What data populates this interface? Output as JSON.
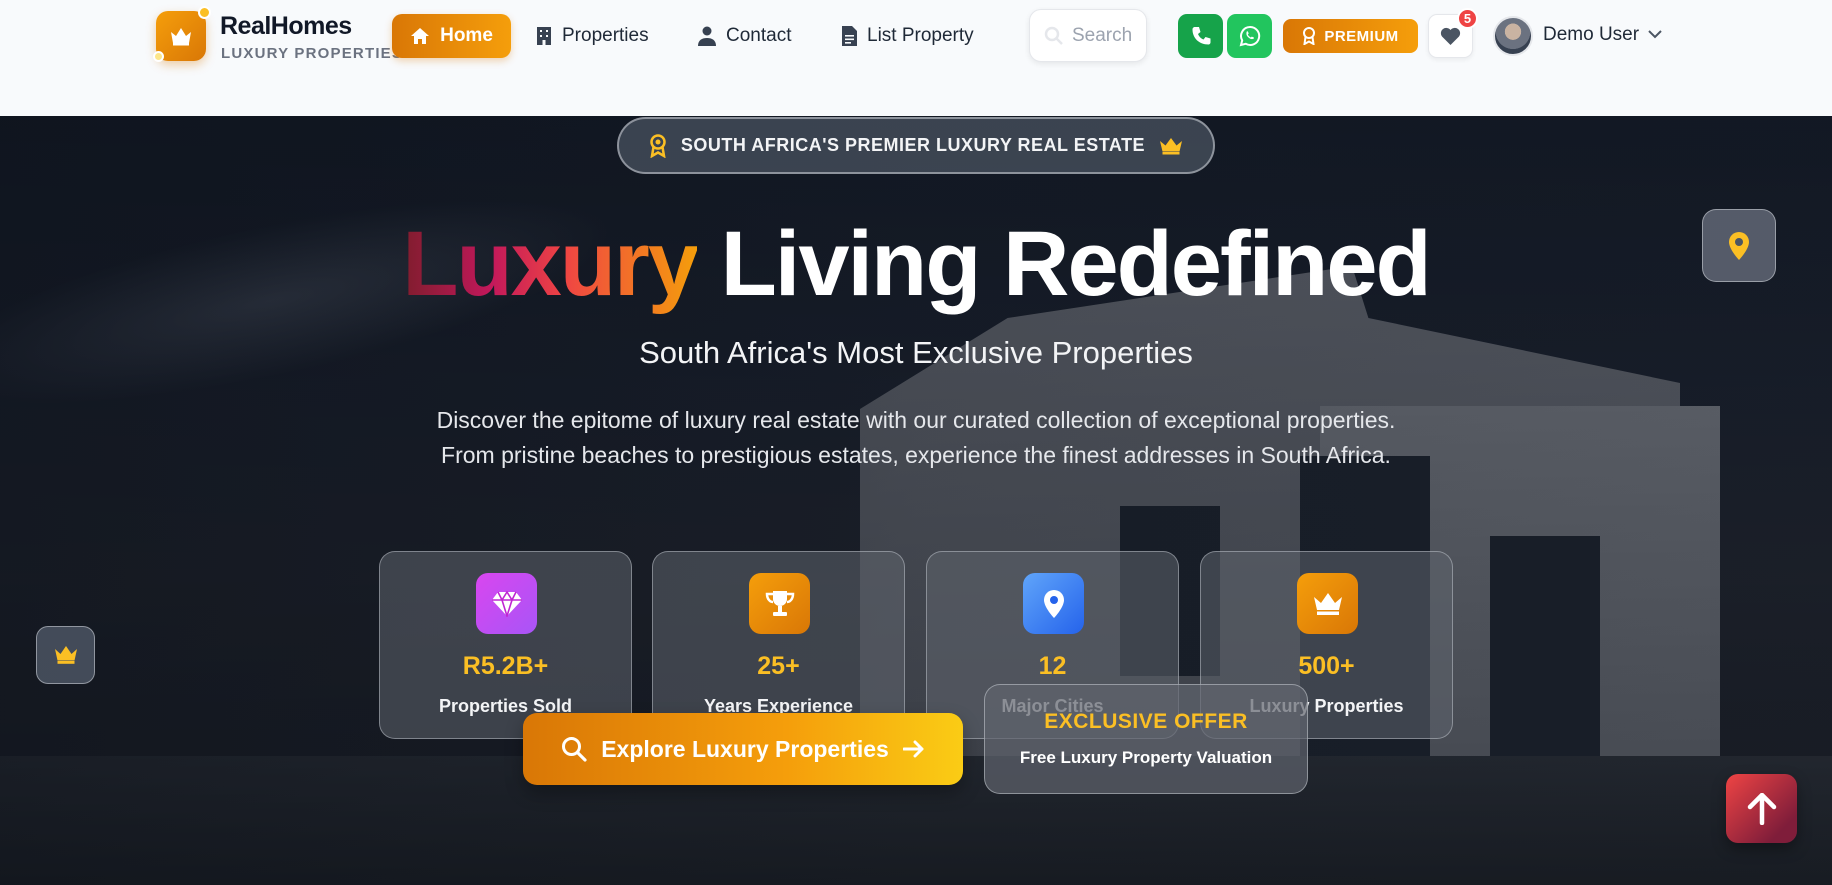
{
  "brand": {
    "name": "RealHomes",
    "tagline": "LUXURY PROPERTIES"
  },
  "nav": {
    "items": [
      {
        "label": "Home",
        "icon": "home-icon",
        "active": true
      },
      {
        "label": "Properties",
        "icon": "building-icon",
        "active": false
      },
      {
        "label": "Contact",
        "icon": "user-icon",
        "active": false
      },
      {
        "label": "List Property",
        "icon": "document-icon",
        "active": false
      }
    ]
  },
  "search": {
    "placeholder": "Search"
  },
  "header_actions": {
    "premium_label": "PREMIUM",
    "favorites_count": "5"
  },
  "user": {
    "name": "Demo User"
  },
  "hero": {
    "tag": "SOUTH AFRICA'S PREMIER LUXURY REAL ESTATE",
    "title_highlight": "Luxury",
    "title_rest": "Living Redefined",
    "subtitle": "South Africa's Most Exclusive Properties",
    "description": "Discover the epitome of luxury real estate with our curated collection of exceptional properties. From pristine beaches to prestigious estates, experience the finest addresses in South Africa."
  },
  "stats": [
    {
      "value": "R5.2B+",
      "label": "Properties Sold",
      "icon": "diamond-icon",
      "color": "#c026d3"
    },
    {
      "value": "25+",
      "label": "Years Experience",
      "icon": "trophy-icon",
      "color": "#f59e0b"
    },
    {
      "value": "12",
      "label": "Major Cities",
      "icon": "map-pin-icon",
      "color": "#3b82f6"
    },
    {
      "value": "500+",
      "label": "Luxury Properties",
      "icon": "crown-icon",
      "color": "#d97706"
    }
  ],
  "cta": {
    "explore_label": "Explore Luxury Properties",
    "offer_title": "EXCLUSIVE OFFER",
    "offer_subtitle": "Free Luxury Property Valuation"
  },
  "colors": {
    "accent": "#f59e0b",
    "accent_dark": "#d97706",
    "stat_value": "#fbbf24",
    "phone_green": "#16a34a",
    "whatsapp_green": "#22c55e",
    "badge_red": "#ef4444"
  }
}
